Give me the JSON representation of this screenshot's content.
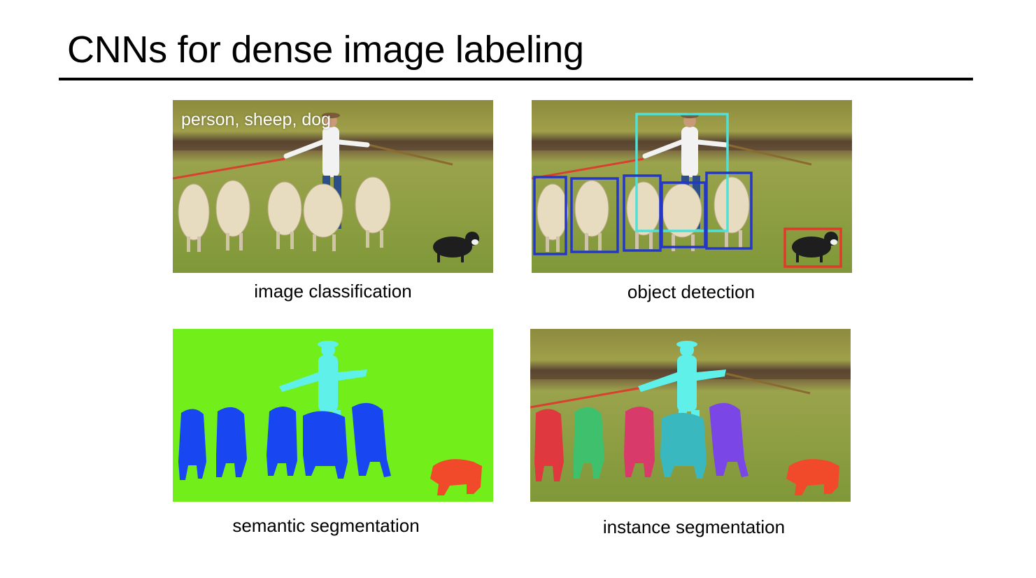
{
  "title": "CNNs for dense image labeling",
  "panels": {
    "classification": {
      "caption": "image classification",
      "overlay_text": "person, sheep, dog"
    },
    "detection": {
      "caption": "object detection",
      "box_colors": {
        "person": "#4fe0d8",
        "sheep": "#2437c8",
        "dog": "#e03a2a"
      }
    },
    "semantic": {
      "caption": "semantic segmentation",
      "class_colors": {
        "background": "#72ee1b",
        "person": "#5ff0ea",
        "sheep": "#1847f2",
        "dog": "#f04a2a"
      }
    },
    "instance": {
      "caption": "instance segmentation",
      "instance_colors": [
        "#e0383f",
        "#3fc06c",
        "#d83a6a",
        "#3ab8c0",
        "#7a46e6",
        "#5ff0ea",
        "#f04a2a"
      ]
    }
  }
}
